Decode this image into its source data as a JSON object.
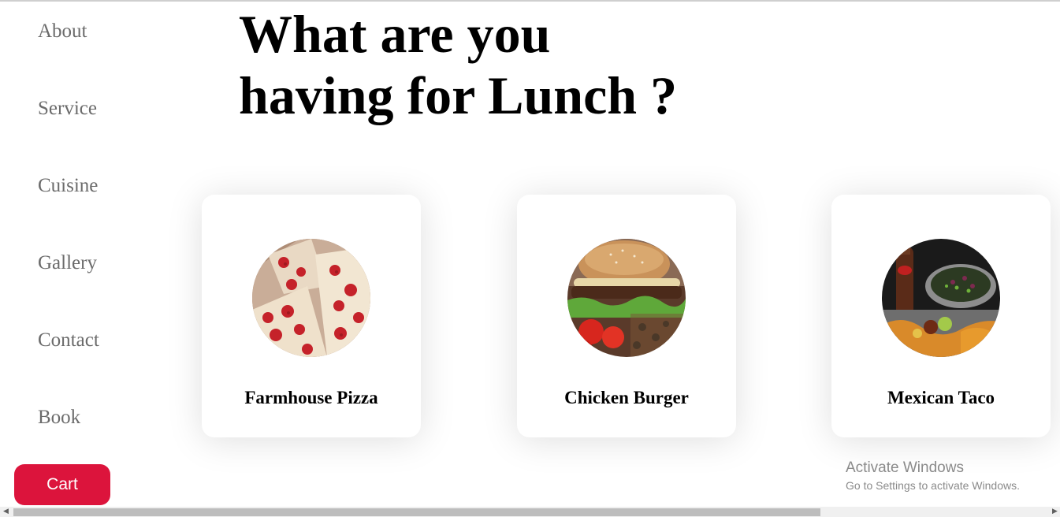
{
  "nav": {
    "items": [
      {
        "label": "About"
      },
      {
        "label": "Service"
      },
      {
        "label": "Cuisine"
      },
      {
        "label": "Gallery"
      },
      {
        "label": "Contact"
      },
      {
        "label": "Book"
      }
    ]
  },
  "cart": {
    "label": "Cart",
    "color": "#dc143c"
  },
  "hero": {
    "line1": "What are you",
    "line2": "having for Lunch ?"
  },
  "cards": [
    {
      "title": "Farmhouse Pizza",
      "icon": "pizza-image"
    },
    {
      "title": "Chicken Burger",
      "icon": "burger-image"
    },
    {
      "title": "Mexican Taco",
      "icon": "taco-image"
    }
  ],
  "watermark": {
    "line1": "Activate Windows",
    "line2": "Go to Settings to activate Windows."
  }
}
